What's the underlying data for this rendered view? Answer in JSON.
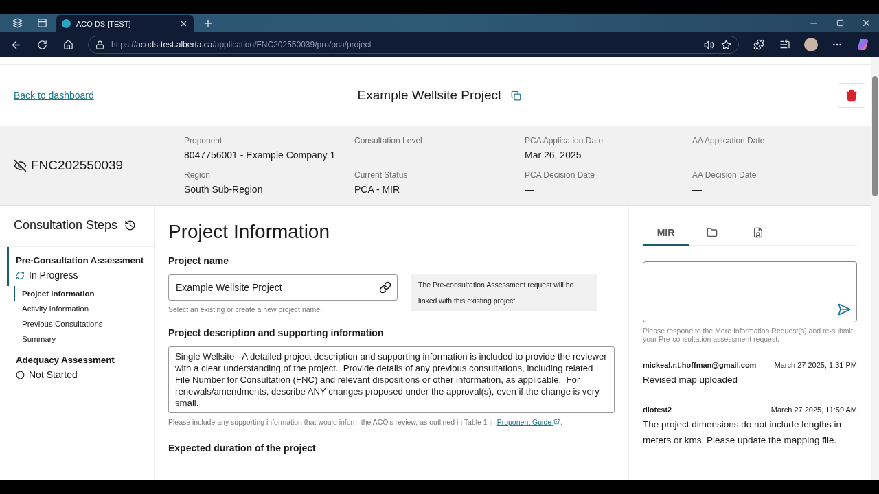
{
  "browser": {
    "tab_title": "ACO DS [TEST]",
    "url": {
      "scheme": "https://",
      "host": "acods-test.alberta.ca",
      "path": "/application/FNC202550039/pro/pca/project"
    }
  },
  "header": {
    "back_link": "Back to dashboard",
    "title": "Example Wellsite Project"
  },
  "summary": {
    "file_number": "FNC202550039",
    "fields": [
      {
        "label": "Proponent",
        "value": "8047756001 - Example Company 1"
      },
      {
        "label": "Consultation Level",
        "value": "—"
      },
      {
        "label": "PCA Application Date",
        "value": "Mar 26, 2025"
      },
      {
        "label": "AA Application Date",
        "value": "—"
      },
      {
        "label": "Region",
        "value": "South Sub-Region"
      },
      {
        "label": "Current Status",
        "value": "PCA - MIR"
      },
      {
        "label": "PCA Decision Date",
        "value": "—"
      },
      {
        "label": "AA Decision Date",
        "value": "—"
      }
    ]
  },
  "sidebar": {
    "heading": "Consultation Steps",
    "sections": [
      {
        "title": "Pre-Consultation Assessment",
        "status": "In Progress",
        "kind": "in_progress",
        "expanded": true,
        "children": [
          {
            "label": "Project Information",
            "selected": true
          },
          {
            "label": "Activity Information",
            "selected": false
          },
          {
            "label": "Previous Consultations",
            "selected": false
          },
          {
            "label": "Summary",
            "selected": false
          }
        ]
      },
      {
        "title": "Adequacy Assessment",
        "status": "Not Started",
        "kind": "not_started",
        "expanded": false
      }
    ]
  },
  "content": {
    "heading": "Project Information",
    "project_name": {
      "label": "Project name",
      "value": "Example Wellsite Project",
      "hint": "Select an existing or create a new project name.",
      "notice": "The Pre-consultation Assessment request will be linked with this existing project."
    },
    "description": {
      "label": "Project description and supporting information",
      "value": "Single Wellsite - A detailed project description and supporting information is included to provide the reviewer with a clear understanding of the project.  Provide details of any previous consultations, including related File Number for Consultation (FNC) and relevant dispositions or other information, as applicable.  For renewals/amendments, describe ANY changes proposed under the approval(s), even if the change is very small.",
      "hint": "Please include any supporting information that would inform the ACO's review, as outlined in Table 1 in",
      "hint_link": "Proponent Guide",
      "hint_end": "."
    },
    "next_label": "Expected duration of the project"
  },
  "panel": {
    "tabs": [
      {
        "kind": "text",
        "label": "MIR",
        "selected": true
      },
      {
        "kind": "folder",
        "selected": false
      },
      {
        "kind": "document",
        "selected": false
      }
    ],
    "hint": "Please respond to the More Information Request(s) and re-submit your Pre-consultation assessment request.",
    "messages": [
      {
        "author": "mickeal.r.t.hoffman@gmail.com",
        "time": "March 27 2025, 1:31 PM",
        "body": "Revised map uploaded"
      },
      {
        "author": "diotest2",
        "time": "March 27 2025, 11:59 AM",
        "body": "The project dimensions do not include lengths in meters or kms. Please update the mapping file."
      }
    ]
  }
}
